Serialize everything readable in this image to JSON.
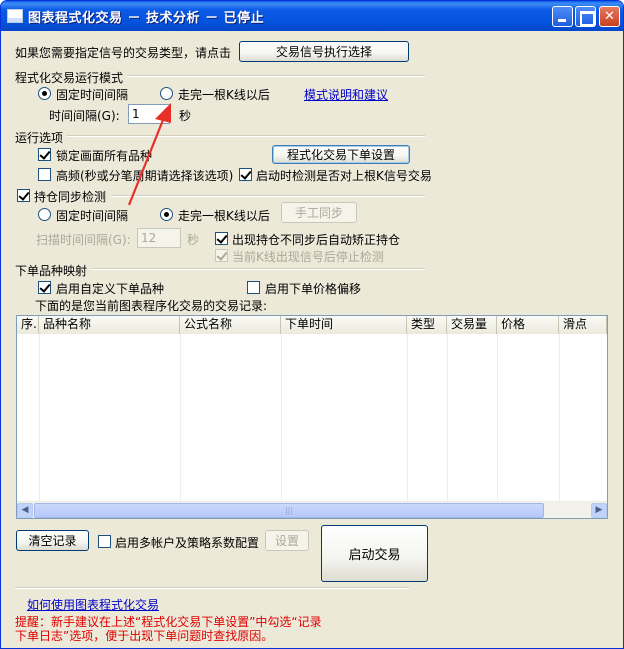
{
  "window": {
    "title": "图表程式化交易 － 技术分析 － 已停止"
  },
  "signal": {
    "prompt": "如果您需要指定信号的交易类型，请点击",
    "button": "交易信号执行选择"
  },
  "mode": {
    "title": "程式化交易运行模式",
    "option_fixed": "固定时间间隔",
    "option_kline": "走完一根K线以后",
    "link": "模式说明和建议",
    "interval_label": "时间间隔(G):",
    "interval_value": "1",
    "interval_unit": "秒"
  },
  "run_options": {
    "title": "运行选项",
    "lock_products": "锁定画面所有品种",
    "order_settings_button": "程式化交易下单设置",
    "high_freq": "高频(秒或分笔周期请选择该选项)",
    "startup_check": "启动时检测是否对上根K信号交易"
  },
  "position_sync": {
    "title": "持仓同步检测",
    "option_fixed": "固定时间间隔",
    "option_kline": "走完一根K线以后",
    "manual_button": "手工同步",
    "scan_label": "扫描时间间隔(G):",
    "scan_value": "12",
    "scan_unit": "秒",
    "auto_fix": "出现持仓不同步后自动矫正持仓",
    "stop_check": "当前K线出现信号后停止检测"
  },
  "mapping": {
    "title": "下单品种映射",
    "custom_products": "启用自定义下单品种",
    "price_offset": "启用下单价格偏移",
    "records_caption": "下面的是您当前图表程序化交易的交易记录:"
  },
  "table": {
    "columns": [
      "序.",
      "品种名称",
      "公式名称",
      "下单时间",
      "类型",
      "交易量",
      "价格",
      "滑点"
    ]
  },
  "bottom": {
    "clear_button": "清空记录",
    "multi_account": "启用多帐户及策略系数配置",
    "settings_button": "设置",
    "start_button": "启动交易",
    "help_link": "如何使用图表程式化交易",
    "reminder_line1": "提醒：新手建议在上述“程式化交易下单设置”中勾选“记录",
    "reminder_line2": "下单日志”选项，便于出现下单问题时查找原因。"
  },
  "colors": {
    "title_bar": "#0553dd",
    "dialog_bg": "#ece9d8",
    "link": "#0000cc",
    "warning": "#e00000",
    "arrow": "#e8302a"
  },
  "icons": {
    "minimize": "minimize-icon",
    "maximize": "maximize-icon",
    "close": "close-icon"
  }
}
